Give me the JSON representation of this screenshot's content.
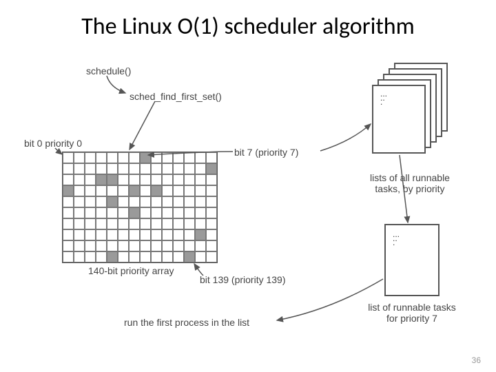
{
  "title": "The Linux O(1) scheduler algorithm",
  "labels": {
    "schedule": "schedule()",
    "sched_find": "sched_find_first_set()",
    "bit0": "bit 0 priority 0",
    "bit7": "bit 7 (priority 7)",
    "bit139": "bit 139 (priority 139)",
    "array_caption": "140-bit priority array",
    "stack_caption": "lists of all runnable\ntasks, by priority",
    "single_caption": "list of runnable tasks\nfor priority 7",
    "run_first": "run the first process in the list"
  },
  "grid": {
    "cols": 14,
    "rows": 10,
    "filled": [
      [
        0,
        7
      ],
      [
        1,
        13
      ],
      [
        2,
        3
      ],
      [
        2,
        4
      ],
      [
        3,
        0
      ],
      [
        3,
        6
      ],
      [
        3,
        8
      ],
      [
        4,
        4
      ],
      [
        5,
        6
      ],
      [
        7,
        12
      ],
      [
        9,
        4
      ],
      [
        9,
        11
      ]
    ]
  },
  "page_number": "36"
}
